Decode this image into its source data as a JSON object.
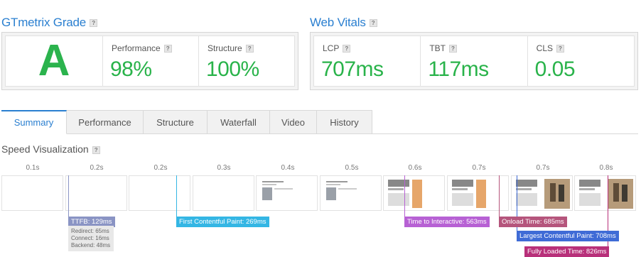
{
  "gtmetrix": {
    "title": "GTmetrix Grade",
    "help": "?",
    "grade": "A",
    "performance_label": "Performance",
    "performance_value": "98%",
    "structure_label": "Structure",
    "structure_value": "100%"
  },
  "vitals": {
    "title": "Web Vitals",
    "help": "?",
    "lcp_label": "LCP",
    "lcp_value": "707ms",
    "tbt_label": "TBT",
    "tbt_value": "117ms",
    "cls_label": "CLS",
    "cls_value": "0.05"
  },
  "tabs": [
    "Summary",
    "Performance",
    "Structure",
    "Waterfall",
    "Video",
    "History"
  ],
  "active_tab": "Summary",
  "speed": {
    "title": "Speed Visualization",
    "help": "?",
    "ticks": [
      "0.1s",
      "0.2s",
      "0.2s",
      "0.3s",
      "0.4s",
      "0.5s",
      "0.6s",
      "0.7s",
      "0.7s",
      "0.8s"
    ]
  },
  "markers": {
    "ttfb": {
      "label": "TTFB: 129ms",
      "color": "#8a94c4"
    },
    "ttfb_redirect": "Redirect: 65ms",
    "ttfb_connect": "Connect: 16ms",
    "ttfb_backend": "Backend: 48ms",
    "fcp": {
      "label": "First Contentful Paint: 269ms",
      "color": "#34b6e4"
    },
    "tti": {
      "label": "Time to Interactive: 563ms",
      "color": "#b761d4"
    },
    "onload": {
      "label": "Onload Time: 685ms",
      "color": "#b5557c"
    },
    "lcp": {
      "label": "Largest Contentful Paint: 708ms",
      "color": "#3f6bd6"
    },
    "fully": {
      "label": "Fully Loaded Time: 826ms",
      "color": "#b8307a"
    }
  },
  "colors": {
    "accent": "#2a7fd0",
    "grade_green": "#2bb34d"
  }
}
